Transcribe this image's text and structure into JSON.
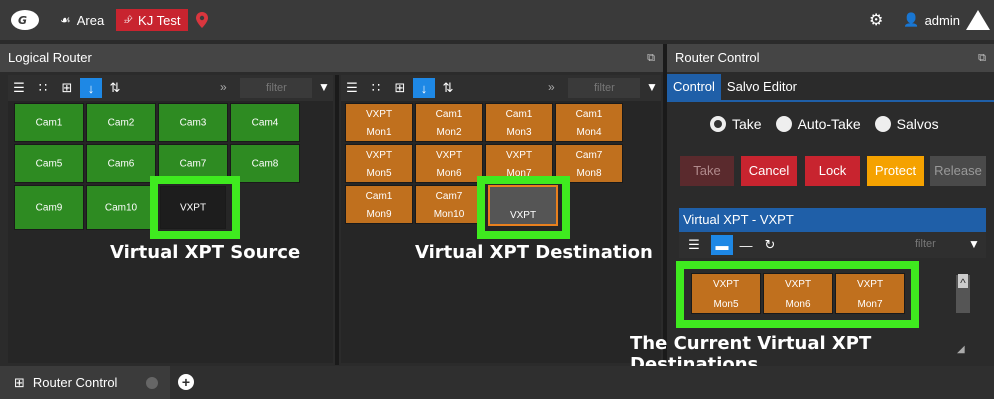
{
  "topbar": {
    "area_label": "Area",
    "kj_label": "KJ Test",
    "user_label": "admin"
  },
  "logical_router": {
    "title": "Logical Router",
    "filter_placeholder_left": "filter",
    "filter_placeholder_right": "filter",
    "sources": [
      {
        "label": "Cam1"
      },
      {
        "label": "Cam2"
      },
      {
        "label": "Cam3"
      },
      {
        "label": "Cam4"
      },
      {
        "label": "Cam5"
      },
      {
        "label": "Cam6"
      },
      {
        "label": "Cam7"
      },
      {
        "label": "Cam8"
      },
      {
        "label": "Cam9"
      },
      {
        "label": "Cam10"
      },
      {
        "label": "VXPT"
      }
    ],
    "destinations": [
      {
        "top": "VXPT",
        "bottom": "Mon1"
      },
      {
        "top": "Cam1",
        "bottom": "Mon2"
      },
      {
        "top": "Cam1",
        "bottom": "Mon3"
      },
      {
        "top": "Cam1",
        "bottom": "Mon4"
      },
      {
        "top": "VXPT",
        "bottom": "Mon5"
      },
      {
        "top": "VXPT",
        "bottom": "Mon6"
      },
      {
        "top": "VXPT",
        "bottom": "Mon7"
      },
      {
        "top": "Cam7",
        "bottom": "Mon8"
      },
      {
        "top": "Cam1",
        "bottom": "Mon9"
      },
      {
        "top": "Cam7",
        "bottom": "Mon10"
      },
      {
        "top": "",
        "bottom": "VXPT"
      }
    ]
  },
  "captions": {
    "source": "Virtual XPT Source",
    "destination": "Virtual XPT Destination",
    "current": "The Current Virtual XPT Destinations"
  },
  "router_control": {
    "title": "Router Control",
    "tabs": [
      "Control",
      "Salvo Editor"
    ],
    "radios": [
      "Take",
      "Auto-Take",
      "Salvos"
    ],
    "buttons": [
      "Take",
      "Cancel",
      "Lock",
      "Protect",
      "Release"
    ],
    "virtual_xpt_title": "Virtual XPT - VXPT",
    "filter_placeholder": "filter",
    "vxpt_destinations": [
      {
        "top": "VXPT",
        "bottom": "Mon5"
      },
      {
        "top": "VXPT",
        "bottom": "Mon6"
      },
      {
        "top": "VXPT",
        "bottom": "Mon7"
      }
    ]
  },
  "bottom": {
    "tab_label": "Router Control"
  },
  "colors": {
    "green_tile": "#2e8b22",
    "orange_tile": "#c0701e",
    "highlight": "#3fea1f",
    "accent_blue": "#1f5fa8",
    "cancel_red": "#c8242f",
    "protect_orange": "#f5a200"
  }
}
